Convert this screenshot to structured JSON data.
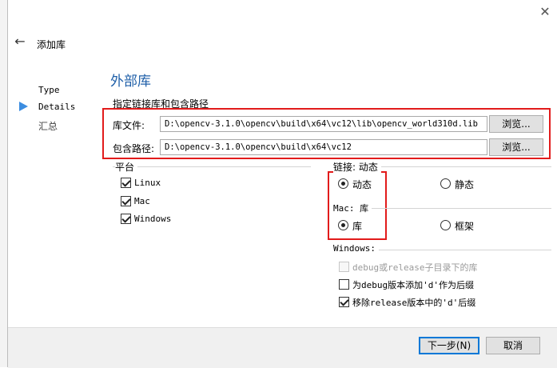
{
  "wizard": {
    "title": "添加库",
    "nav": [
      {
        "label": "Type",
        "active": false
      },
      {
        "label": "Details",
        "active": true
      },
      {
        "label": "汇总",
        "active": false
      }
    ]
  },
  "page": {
    "heading": "外部库",
    "sublabel": "指定链接库和包含路径"
  },
  "fields": {
    "lib_file": {
      "label": "库文件:",
      "value": "D:\\opencv-3.1.0\\opencv\\build\\x64\\vc12\\lib\\opencv_world310d.lib",
      "browse_label": "浏览..."
    },
    "include_path": {
      "label": "包含路径:",
      "value": "D:\\opencv-3.1.0\\opencv\\build\\x64\\vc12",
      "browse_label": "浏览..."
    }
  },
  "platform": {
    "title": "平台",
    "options": [
      {
        "label": "Linux",
        "checked": true
      },
      {
        "label": "Mac",
        "checked": true
      },
      {
        "label": "Windows",
        "checked": true
      }
    ]
  },
  "linking": {
    "title": "链接: 动态",
    "dynamic_label": "动态",
    "static_label": "静态",
    "selected": "动态"
  },
  "mac": {
    "title": "Mac: 库",
    "library_label": "库",
    "framework_label": "框架",
    "selected": "库"
  },
  "windows": {
    "title": "Windows:",
    "options": [
      {
        "label": "debug或release子目录下的库",
        "checked": false,
        "disabled": true
      },
      {
        "label": "为debug版本添加'd'作为后缀",
        "checked": false,
        "disabled": false
      },
      {
        "label": "移除release版本中的'd'后缀",
        "checked": true,
        "disabled": false
      }
    ]
  },
  "footer": {
    "next_label": "下一步(N)",
    "cancel_label": "取消"
  },
  "colors": {
    "accent": "#1f5fa8",
    "highlight": "#e21b1b"
  },
  "icons": {
    "back": "arrow-left-icon",
    "close": "close-icon",
    "nav_current": "triangle-right-icon"
  }
}
